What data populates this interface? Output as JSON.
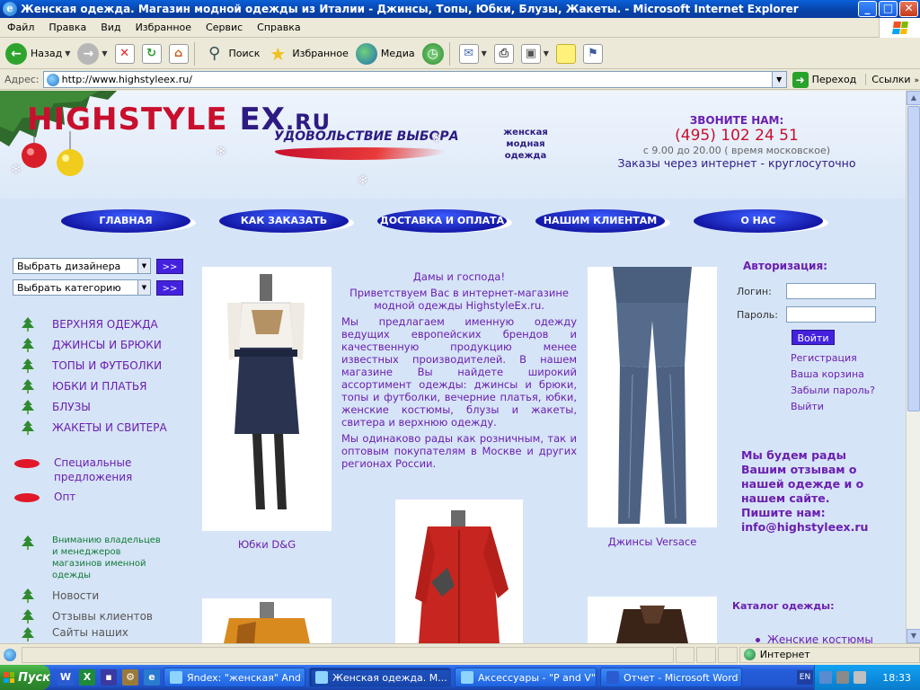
{
  "window": {
    "title": "Женская одежда. Магазин модной одежды из Италии - Джинсы, Топы, Юбки, Блузы, Жакеты. - Microsoft Internet Explorer",
    "minimize": "_",
    "maximize": "□",
    "close": "✕"
  },
  "menu": [
    "Файл",
    "Правка",
    "Вид",
    "Избранное",
    "Сервис",
    "Справка"
  ],
  "toolbar": {
    "back": "Назад",
    "search": "Поиск",
    "favorites": "Избранное",
    "media": "Медиа"
  },
  "address": {
    "label": "Адрес:",
    "url": "http://www.highstyleex.ru/",
    "go": "Переход",
    "links": "Ссылки"
  },
  "site": {
    "logo_part1": "HIGHSTYLE",
    "logo_part2": "EX",
    "logo_part3": ".RU",
    "slogan": "УДОВОЛЬСТВИЕ ВЫБОРА",
    "tagline": "женская модная одежда",
    "contact": {
      "call": "ЗВОНИТЕ НАМ:",
      "phone": "(495) 102 24 51",
      "hours": "с 9.00 до 20.00 ( время московское)",
      "orders": "Заказы через интернет - круглосуточно"
    },
    "nav": [
      "ГЛАВНАЯ",
      "КАК ЗАКАЗАТЬ",
      "ДОСТАВКА И ОПЛАТА",
      "НАШИМ КЛИЕНТАМ",
      "О НАС"
    ],
    "left": {
      "select_designer": "Выбрать дизайнера",
      "select_category": "Выбрать категорию",
      "go_label": ">>",
      "categories": [
        "ВЕРХНЯЯ ОДЕЖДА",
        "ДЖИНСЫ И БРЮКИ",
        "ТОПЫ И ФУТБОЛКИ",
        "ЮБКИ И ПЛАТЬЯ",
        "БЛУЗЫ",
        "ЖАКЕТЫ И СВИТЕРА"
      ],
      "specials": [
        "Специальные предложения",
        "Опт"
      ],
      "notice": "Вниманию владельцев и менеджеров магазинов именной одежды",
      "misc": [
        "Новости",
        "Отзывы клиентов",
        "Сайты наших партнеров"
      ]
    },
    "center": {
      "greeting": "Дамы и господа!",
      "welcome": "Приветствуем Вас в интернет-магазине модной одежды HighstyleEx.ru.",
      "para1": "Мы предлагаем именную одежду ведущих европейских брендов и качественную продукцию менее известных производителей. В нашем магазине Вы найдете широкий ассортимент одежды: джинсы и брюки, топы и футболки, вечерние платья, юбки, женские костюмы, блузы и жакеты, свитера и верхнюю одежду.",
      "para2": "Мы одинаково рады как розничным, так и оптовым покупателям в Москве и других регионах России.",
      "caption_skirt": "Юбки D&G",
      "caption_jeans": "Джинсы Versace"
    },
    "auth": {
      "title": "Авторизация:",
      "login_label": "Логин:",
      "password_label": "Пароль:",
      "login_button": "Войти",
      "links": [
        "Регистрация",
        "Ваша корзина",
        "Забыли пароль?",
        "Выйти"
      ]
    },
    "feedback": "Мы будем рады Вашим отзывам о нашей одежде и о нашем сайте.",
    "write_us": "Пишите нам:",
    "email": "info@highstyleex.ru",
    "catalog_title": "Каталог одежды:",
    "catalog_first": "Женские костюмы"
  },
  "status": {
    "zone": "Интернет"
  },
  "taskbar": {
    "start": "Пуск",
    "tasks": [
      "Яndex: \"женская\" And \"...",
      "Женская одежда. М...",
      "Аксессуары - \"P and V\" ...",
      "Отчет - Microsoft Word"
    ],
    "lang": "EN",
    "clock": "18:33"
  },
  "colors": {
    "accent_purple": "#6a1fb0",
    "brand_red": "#c8102e",
    "brand_blue": "#2d1b82",
    "button_blue": "#4422dd"
  }
}
